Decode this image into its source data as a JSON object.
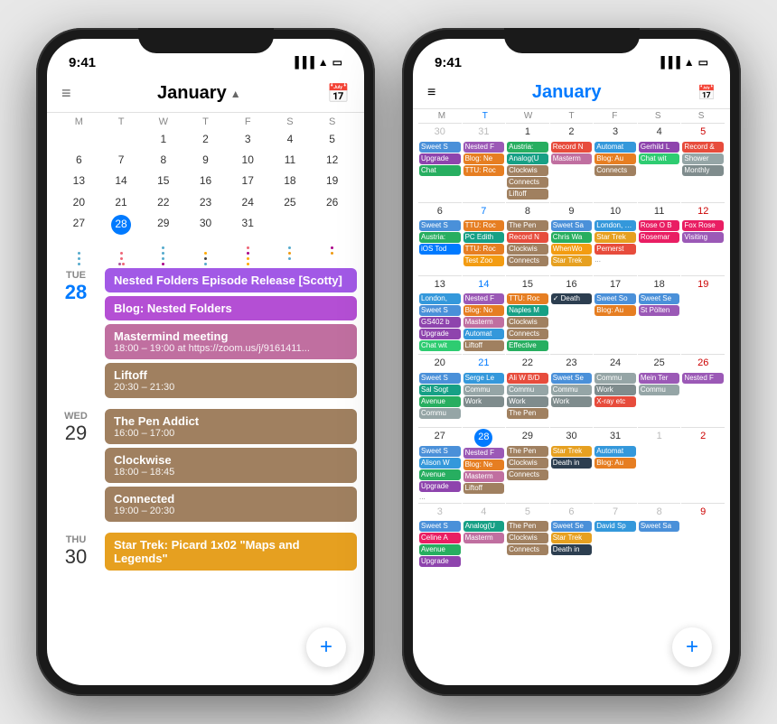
{
  "left_phone": {
    "status_time": "9:41",
    "header_title": "January",
    "weekdays": [
      "M",
      "T",
      "W",
      "T",
      "F",
      "S",
      "S"
    ],
    "calendar_weeks": [
      [
        null,
        null,
        1,
        2,
        3,
        4,
        5
      ],
      [
        6,
        7,
        8,
        9,
        10,
        11,
        12
      ],
      [
        13,
        14,
        15,
        16,
        17,
        18,
        19
      ],
      [
        20,
        21,
        22,
        23,
        24,
        25,
        26
      ],
      [
        27,
        28,
        29,
        30,
        31,
        null,
        null
      ]
    ],
    "today": 28,
    "events": [
      {
        "day_name": "TUE",
        "day_num": "28",
        "is_today": true,
        "items": [
          {
            "title": "Nested Folders Episode Release [Scotty]",
            "time": "",
            "color": "#a259e6"
          },
          {
            "title": "Blog: Nested Folders",
            "time": "",
            "color": "#b44fd4"
          },
          {
            "title": "Mastermind meeting",
            "time": "18:00 – 19:00 at https://zoom.us/j/9161411...",
            "color": "#c06fa0"
          },
          {
            "title": "Liftoff",
            "time": "20:30 – 21:30",
            "color": "#a08060"
          }
        ]
      },
      {
        "day_name": "WED",
        "day_num": "29",
        "is_today": false,
        "items": [
          {
            "title": "The Pen Addict",
            "time": "16:00 – 17:00",
            "color": "#a08060"
          },
          {
            "title": "Clockwise",
            "time": "18:00 – 18:45",
            "color": "#a08060"
          },
          {
            "title": "Connected",
            "time": "19:00 – 20:30",
            "color": "#a08060"
          }
        ]
      },
      {
        "day_name": "THU",
        "day_num": "30",
        "is_today": false,
        "items": [
          {
            "title": "Star Trek: Picard 1x02 \"Maps and Legends\"",
            "time": "",
            "color": "#e6a020"
          }
        ]
      }
    ],
    "fab_label": "+"
  },
  "right_phone": {
    "status_time": "9:41",
    "header_title": "January",
    "weekdays": [
      "M",
      "T",
      "W",
      "T",
      "F",
      "S",
      "S"
    ],
    "today": 28,
    "weeks": [
      {
        "days": [
          30,
          31,
          1,
          2,
          3,
          4,
          5
        ],
        "other": [
          true,
          true,
          false,
          false,
          false,
          false,
          false
        ],
        "events": [
          [
            "Sweet S",
            "Upgrade",
            "Chat"
          ],
          [
            "Nested F",
            "Blog: Ne",
            "TTU: Roc"
          ],
          [
            "Austria:",
            "Analog(U",
            "Clockwis",
            "Connects"
          ],
          [
            "Record N",
            "Masterm"
          ],
          [
            "Automat",
            "Blog: Au",
            "Connects"
          ],
          [
            "Gerhild L",
            "Chat wit"
          ],
          [
            "Record &",
            "Shower",
            "Monthly"
          ]
        ]
      },
      {
        "days": [
          6,
          7,
          8,
          9,
          10,
          11,
          12
        ],
        "other": [
          false,
          false,
          false,
          false,
          false,
          false,
          false
        ],
        "events": [
          [
            "Sweet S",
            "Austria:",
            "iOS Tod"
          ],
          [
            "TTU: Roc",
            "PC Edith",
            "TTU: Roc",
            "Test Zoo"
          ],
          [
            "The Pen",
            "Record N",
            "Clockwis",
            "Connects"
          ],
          [
            "Sweet Sa",
            "Chris Wa",
            "WhenWo",
            "Star Trek"
          ],
          [
            "London, United Kingdom, Jan",
            "Star Trek",
            "Pernerst"
          ],
          [
            "Rose O B",
            "Rosemar"
          ],
          [
            "Fox Rose",
            "Visiting"
          ]
        ]
      },
      {
        "days": [
          13,
          14,
          15,
          16,
          17,
          18,
          19
        ],
        "other": [
          false,
          false,
          false,
          false,
          false,
          false,
          false
        ],
        "events": [
          [
            "London,",
            "Sweet S",
            "GS402 b",
            "Upgrade",
            "Chat wit"
          ],
          [
            "Nested F",
            "Blog: No",
            "Masterm",
            "Automat",
            "Liftoff"
          ],
          [
            "TTU: Roc",
            "Naples M",
            "Clockwis",
            "Connects",
            "Effective"
          ],
          [
            "✓ Death"
          ],
          [
            "Sweet So",
            "Blog: Au"
          ],
          [
            "Sweet Se",
            "St Pölten"
          ],
          []
        ]
      },
      {
        "days": [
          20,
          21,
          22,
          23,
          24,
          25,
          26
        ],
        "other": [
          false,
          false,
          false,
          false,
          false,
          false,
          false
        ],
        "events": [
          [
            "Sweet S",
            "Sal Sogt",
            "Avenue",
            "Commu"
          ],
          [
            "Serge Le",
            "Commu",
            "Work"
          ],
          [
            "Ali W B/D",
            "Commu",
            "Work",
            "The Pen"
          ],
          [
            "Sweet Se",
            "Commu",
            "Work"
          ],
          [
            "Commu",
            "Work",
            "X-ray etc"
          ],
          [
            "Mein Ter",
            "Commu"
          ],
          [
            "Nested F"
          ]
        ]
      },
      {
        "days": [
          27,
          28,
          29,
          30,
          31,
          1,
          2
        ],
        "other": [
          false,
          false,
          false,
          false,
          false,
          true,
          true
        ],
        "events": [
          [
            "Sweet S",
            "Alison W",
            "Avenue",
            "Upgrade"
          ],
          [
            "Nested F",
            "Blog: Ne",
            "Masterm",
            "Liftoff"
          ],
          [
            "The Pen",
            "Clockwis",
            "Connects"
          ],
          [
            "Star Trek",
            "Death in"
          ],
          [
            "Automat",
            "Blog: Au"
          ],
          [],
          []
        ]
      },
      {
        "days": [
          3,
          4,
          5,
          6,
          7,
          8,
          9
        ],
        "other": [
          true,
          true,
          true,
          true,
          true,
          true,
          true
        ],
        "events": [
          [
            "Sweet S",
            "Celine A",
            "Avenue",
            "Upgrade"
          ],
          [
            "Analog(U",
            "Masterm"
          ],
          [
            "The Pen",
            "Clockwis",
            "Connects"
          ],
          [
            "Sweet Se",
            "Star Trek",
            "Death in"
          ],
          [
            "David Sp"
          ],
          [
            "Sweet Sa"
          ],
          []
        ]
      }
    ],
    "event_colors": {
      "Sweet": "#4a90d9",
      "Nested": "#9b59b6",
      "Blog": "#e67e22",
      "Austria": "#27ae60",
      "Analog": "#16a085",
      "Clockwis": "#a08060",
      "Connects": "#a08060",
      "Record": "#e74c3c",
      "Masterm": "#c06fa0",
      "Automat": "#3498db",
      "Gerhild": "#8e44ad",
      "Chat": "#2ecc71",
      "Shower": "#95a5a6",
      "Monthly": "#7f8c8d",
      "TTU": "#e67e22",
      "PC": "#16a085",
      "The Pen": "#a08060",
      "Chris": "#27ae60",
      "WhenWo": "#f39c12",
      "Star Trek": "#e6a020",
      "London": "#3498db",
      "Rose": "#e91e63",
      "Fox": "#e91e63",
      "Visiting": "#9b59b6",
      "Death": "#2c3e50",
      "Naples": "#16a085",
      "Patreon": "#f39c12",
      "Effective": "#27ae60",
      "GS402": "#8e44ad",
      "Serge": "#3498db",
      "Ali": "#e74c3c",
      "Sal": "#16a085",
      "Avenue": "#27ae60",
      "Commu": "#95a5a6",
      "Work": "#7f8c8d",
      "X-ray": "#e74c3c",
      "Mein": "#9b59b6",
      "Alison": "#3498db",
      "Upgrade": "#8e44ad",
      "Liftoff": "#a08060",
      "Celine": "#e91e63",
      "David": "#3498db",
      "iOS": "#007aff",
      "Test": "#f39c12",
      "Pernerst": "#e74c3c",
      "Rosemar": "#e91e63",
      "St": "#9b59b6"
    },
    "fab_label": "+"
  }
}
